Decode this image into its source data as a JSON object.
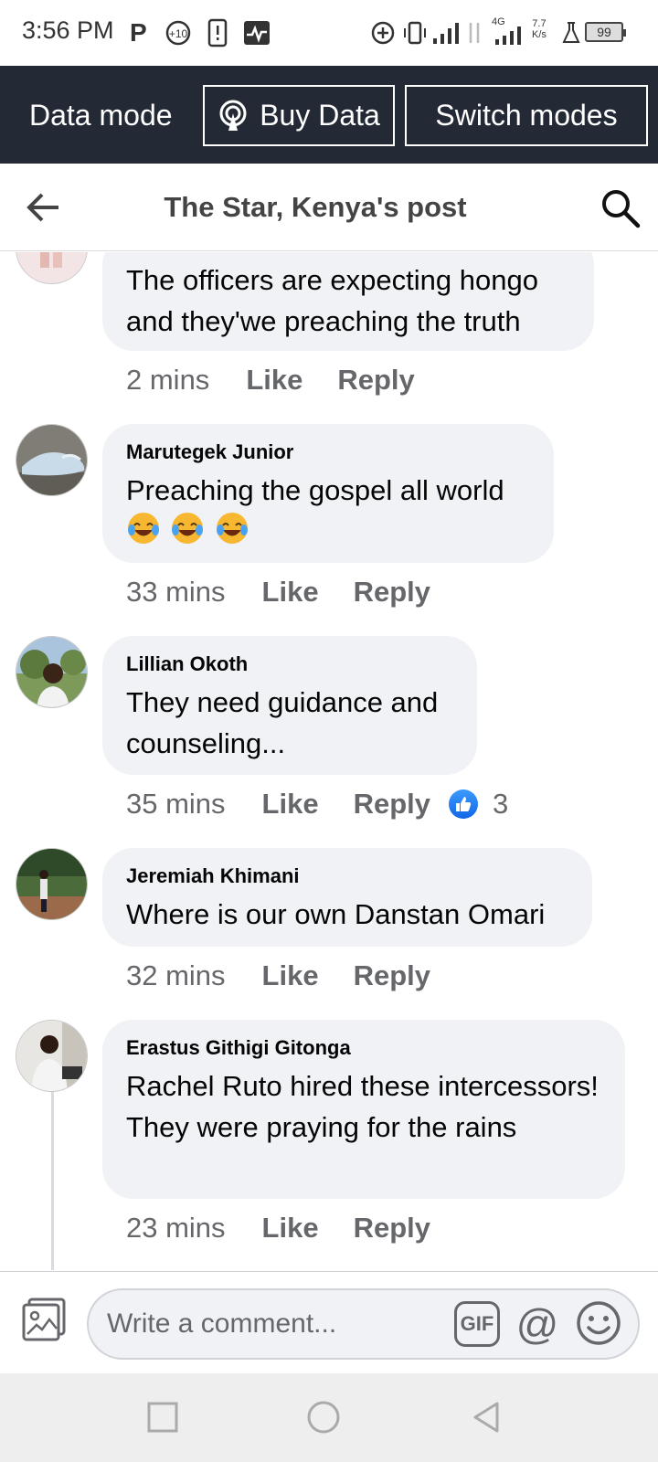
{
  "status_bar": {
    "time": "3:56 PM",
    "p_icon": "P",
    "net_type": "4G",
    "net_speed_value": "7.7",
    "net_speed_unit": "K/s",
    "battery": "99"
  },
  "data_bar": {
    "mode_label": "Data mode",
    "buy_label": "Buy Data",
    "switch_label": "Switch modes"
  },
  "header": {
    "title": "The Star, Kenya's post"
  },
  "comments": [
    {
      "author": "",
      "text": "The officers are expecting hongo and they'we preaching the truth",
      "time": "2 mins",
      "like": "Like",
      "reply": "Reply"
    },
    {
      "author": "Marutegek Junior",
      "text": "Preaching the gospel all world",
      "emoji": [
        "face-with-tears-of-joy",
        "face-with-tears-of-joy",
        "face-with-tears-of-joy"
      ],
      "time": "33 mins",
      "like": "Like",
      "reply": "Reply"
    },
    {
      "author": "Lillian Okoth",
      "text": "They need guidance and counseling...",
      "time": "35 mins",
      "like": "Like",
      "reply": "Reply",
      "reaction_count": "3"
    },
    {
      "author": "Jeremiah Khimani",
      "text": "Where is our own Danstan Omari",
      "time": "32 mins",
      "like": "Like",
      "reply": "Reply"
    },
    {
      "author": "Erastus Githigi Gitonga",
      "text": "Rachel Ruto hired these intercessors! They were praying for the rains",
      "time": "23 mins",
      "like": "Like",
      "reply": "Reply"
    }
  ],
  "composer": {
    "placeholder": "Write a comment...",
    "gif_label": "GIF",
    "mention_label": "@"
  },
  "colors": {
    "data_bar_bg": "#242a35",
    "bubble_bg": "#f0f2f5",
    "meta_text": "#65676b",
    "like_blue": "#1877f2"
  }
}
